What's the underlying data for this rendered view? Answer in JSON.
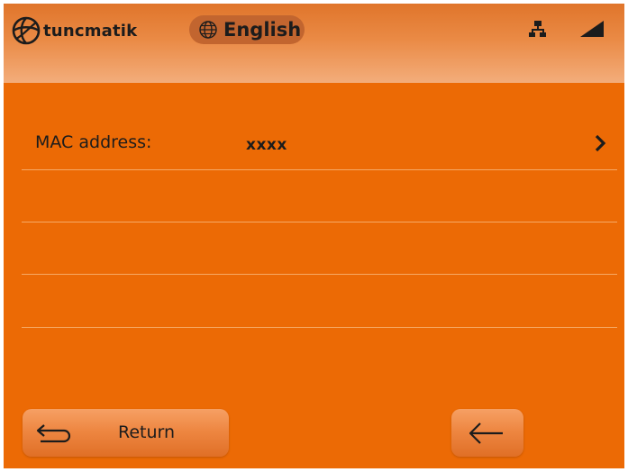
{
  "header": {
    "brand": "tuncmatik",
    "language": "English",
    "network_icon": "network-icon",
    "signal_icon": "signal-icon"
  },
  "list": {
    "rows": [
      {
        "label": "MAC address:",
        "value": "xxxx",
        "icon": "chevron-right-icon"
      },
      {
        "label": "",
        "value": ""
      },
      {
        "label": "",
        "value": ""
      },
      {
        "label": "",
        "value": ""
      }
    ]
  },
  "footer": {
    "return_label": "Return",
    "return_icon": "return-arrow-icon",
    "back_icon": "left-arrow-icon"
  },
  "colors": {
    "background": "#ec6a05",
    "header_top": "#e0752b",
    "header_bottom": "#f3ad7b",
    "text": "#1c1c1c"
  }
}
